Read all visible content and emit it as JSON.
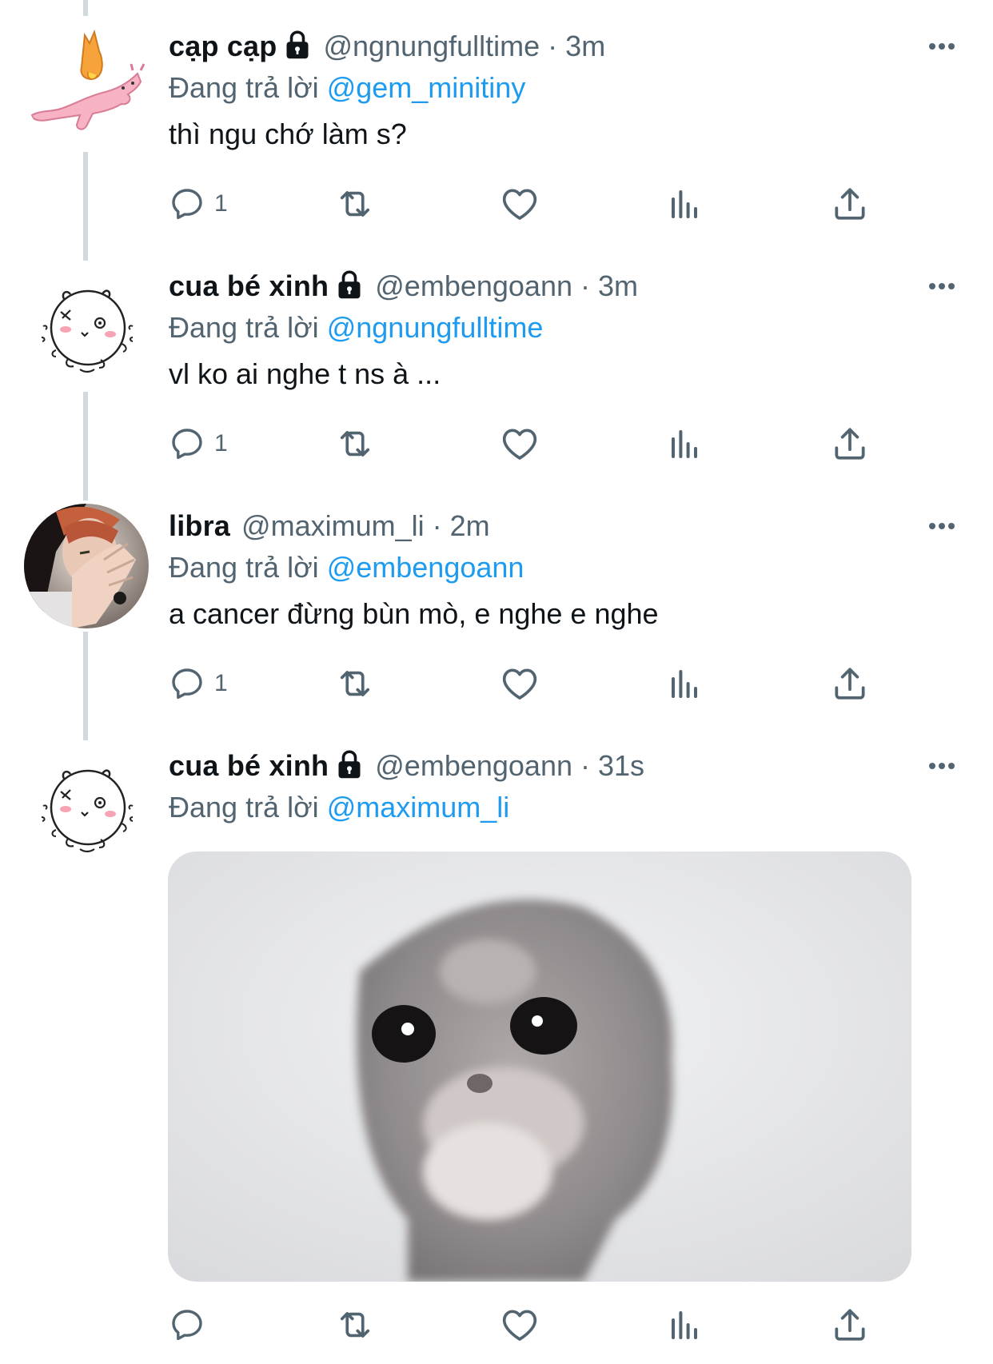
{
  "colors": {
    "link": "#1d9bf0",
    "secondary_text": "#536471",
    "primary_text": "#0f1419",
    "thread_line": "#cfd9de"
  },
  "tweets": [
    {
      "display_name": "cạp cạp",
      "locked": true,
      "handle": "@ngnungfulltime",
      "separator": "·",
      "time": "3m",
      "reply_prefix": "Đang trả lời",
      "reply_to": "@gem_minitiny",
      "text": "thì ngu chớ làm s?",
      "reply_count": "1",
      "avatar_icon": "bunny-sticker-avatar"
    },
    {
      "display_name": "cua bé xinh",
      "locked": true,
      "handle": "@embengoann",
      "separator": "·",
      "time": "3m",
      "reply_prefix": "Đang trả lời",
      "reply_to": "@ngnungfulltime",
      "text": "vl ko ai nghe t ns à ...",
      "reply_count": "1",
      "avatar_icon": "hamster-doodle-avatar"
    },
    {
      "display_name": "libra",
      "locked": false,
      "handle": "@maximum_li",
      "separator": "·",
      "time": "2m",
      "reply_prefix": "Đang trả lời",
      "reply_to": "@embengoann",
      "text": "a cancer đừng bùn mò, e nghe e nghe",
      "reply_count": "1",
      "avatar_icon": "person-photo-avatar"
    },
    {
      "display_name": "cua bé xinh",
      "locked": true,
      "handle": "@embengoann",
      "separator": "·",
      "time": "31s",
      "reply_prefix": "Đang trả lời",
      "reply_to": "@maximum_li",
      "text": "",
      "reply_count": "",
      "avatar_icon": "hamster-doodle-avatar",
      "media": "sad-hamster-photo"
    }
  ]
}
